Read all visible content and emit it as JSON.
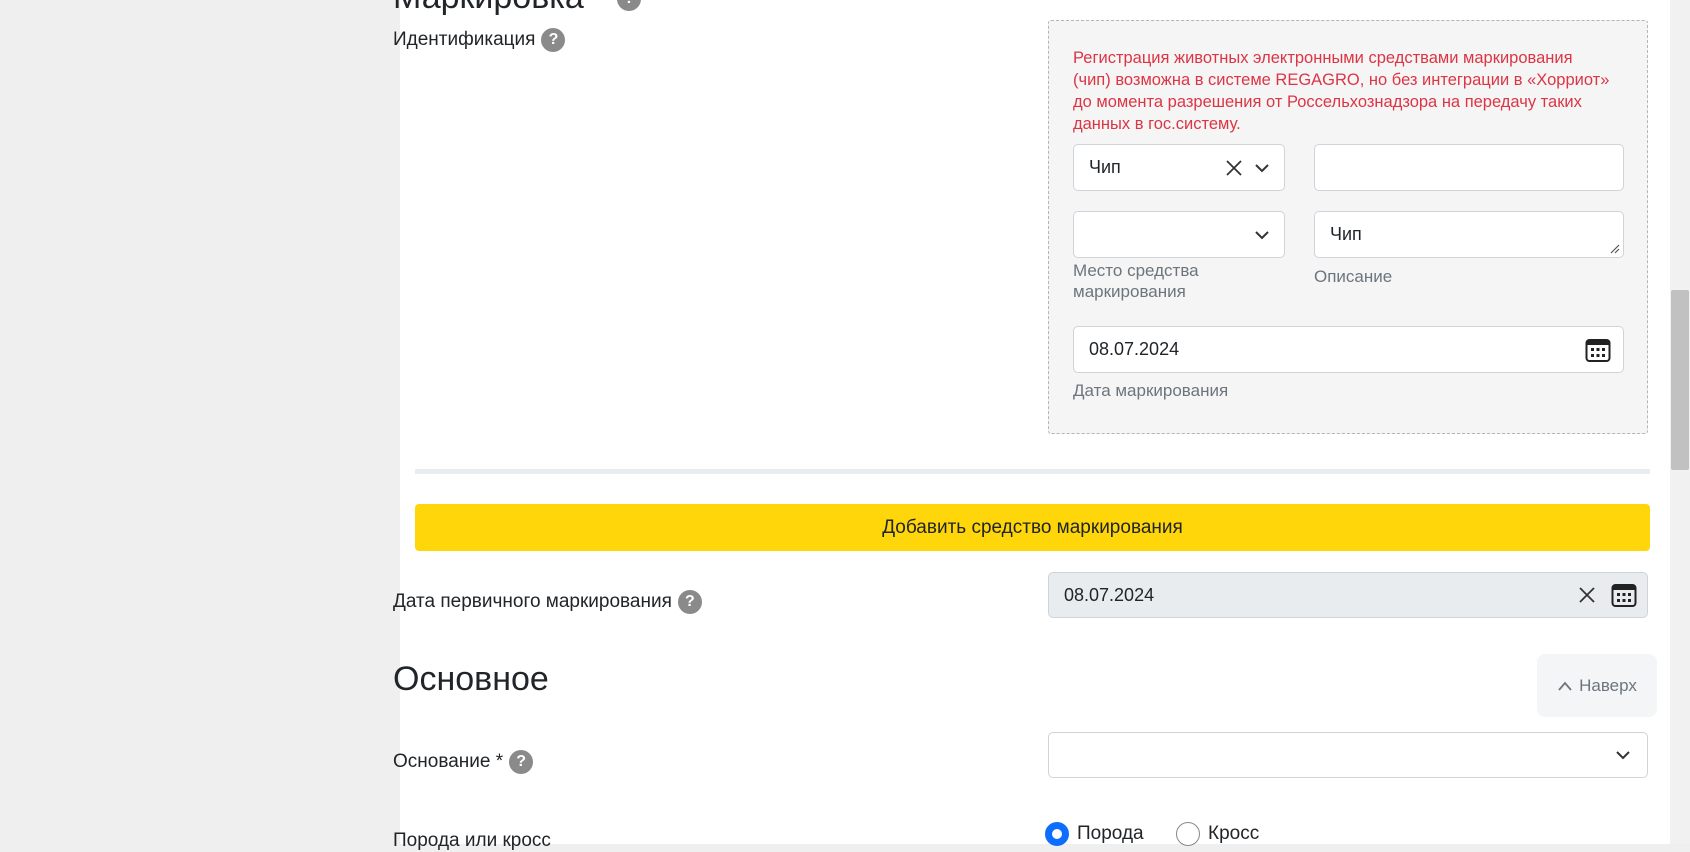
{
  "marking_section": {
    "title": "Маркировка",
    "identification_label": "Идентификация",
    "warning": "Регистрация животных электронными средствами маркирования (чип) возможна в системе REGAGRO, но без интеграции в «Хорриот» до момента разрешения от Россельхознадзора на передачу таких данных в гос.систему.",
    "type_select_value": "Чип",
    "number_input_value": "",
    "place_select_value": "",
    "place_label": "Место средства маркирования",
    "description_value": "Чип",
    "description_label": "Описание",
    "marking_date_value": "08.07.2024",
    "marking_date_label": "Дата маркирования"
  },
  "add_marking_button": "Добавить средство маркирования",
  "primary_marking": {
    "label": "Дата первичного маркирования",
    "value": "08.07.2024"
  },
  "main_section": {
    "title": "Основное",
    "basis_label": "Основание *",
    "basis_value": "",
    "breed_or_cross_label": "Порода или кросс",
    "radio_breed": "Порода",
    "radio_cross": "Кросс"
  },
  "to_top_button": "Наверх",
  "colors": {
    "accent_yellow": "#ffd60a",
    "warning_red": "#dc3545",
    "radio_blue": "#0d6efd"
  }
}
